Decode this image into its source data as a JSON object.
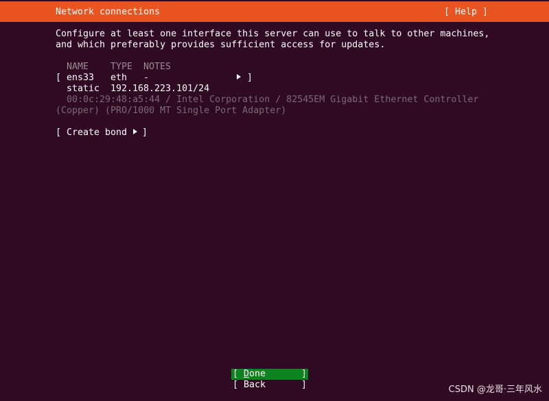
{
  "header": {
    "title": "Network connections",
    "help_label": "[ Help ]"
  },
  "intro": {
    "line1": "Configure at least one interface this server can use to talk to other machines,",
    "line2": "and which preferably provides sufficient access for updates."
  },
  "table": {
    "headers": {
      "name": "NAME",
      "type": "TYPE",
      "notes": "NOTES"
    },
    "rows": [
      {
        "open_bracket": "[",
        "name": "ens33",
        "type": "eth",
        "notes": "-",
        "close_bracket": "]",
        "address_mode": "static",
        "address": "192.168.223.101/24",
        "detail_line1": "00:0c:29:48:a5:44 / Intel Corporation / 82545EM Gigabit Ethernet Controller",
        "detail_line2": "(Copper) (PRO/1000 MT Single Port Adapter)"
      }
    ]
  },
  "create_bond": {
    "open_bracket": "[",
    "label": "Create bond",
    "close_bracket": "]"
  },
  "buttons": {
    "done": {
      "open_bracket": "[",
      "label_first": "D",
      "label_rest": "one",
      "close_bracket": "]"
    },
    "back": {
      "open_bracket": "[",
      "label": "Back",
      "close_bracket": "]"
    }
  },
  "watermark": "CSDN @龙哥·三年风水",
  "colors": {
    "background": "#300a24",
    "header_bar": "#e95420",
    "selected_button": "#0e8420",
    "muted_text": "#9a8a93"
  }
}
